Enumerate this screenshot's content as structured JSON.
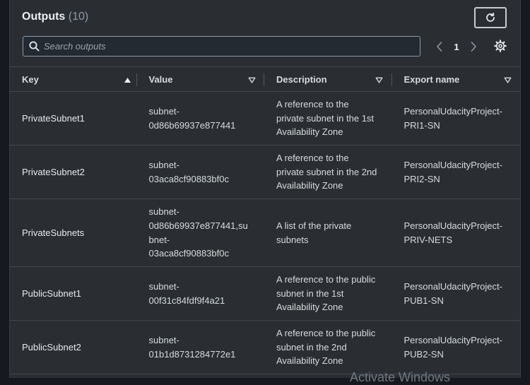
{
  "header": {
    "title": "Outputs",
    "count": "(10)"
  },
  "search": {
    "placeholder": "Search outputs",
    "value": ""
  },
  "pagination": {
    "current_page": "1"
  },
  "table": {
    "columns": [
      {
        "label": "Key",
        "sort": "ascending"
      },
      {
        "label": "Value",
        "sort": "none"
      },
      {
        "label": "Description",
        "sort": "none"
      },
      {
        "label": "Export name",
        "sort": "none"
      }
    ],
    "rows": [
      {
        "key": "PrivateSubnet1",
        "value": "subnet-\n0d86b69937e877441",
        "description": "A reference to the\nprivate subnet in the 1st\nAvailability Zone",
        "export_name": "PersonalUdacityProject-\nPRI1-SN"
      },
      {
        "key": "PrivateSubnet2",
        "value": "subnet-\n03aca8cf90883bf0c",
        "description": "A reference to the\nprivate subnet in the 2nd\nAvailability Zone",
        "export_name": "PersonalUdacityProject-\nPRI2-SN"
      },
      {
        "key": "PrivateSubnets",
        "value": "subnet-\n0d86b69937e877441,su\nbnet-\n03aca8cf90883bf0c",
        "description": "A list of the private\nsubnets",
        "export_name": "PersonalUdacityProject-\nPRIV-NETS"
      },
      {
        "key": "PublicSubnet1",
        "value": "subnet-\n00f31c84fdf9f4a21",
        "description": "A reference to the public\nsubnet in the 1st\nAvailability Zone",
        "export_name": "PersonalUdacityProject-\nPUB1-SN"
      },
      {
        "key": "PublicSubnet2",
        "value": "subnet-\n01b1d8731284772e1",
        "description": "A reference to the public\nsubnet in the 2nd\nAvailability Zone",
        "export_name": "PersonalUdacityProject-\nPUB2-SN"
      }
    ]
  },
  "watermark": "Activate Windows",
  "icons": {
    "refresh": "refresh-icon",
    "search": "search-icon",
    "prev": "chevron-left-icon",
    "next": "chevron-right-icon",
    "settings": "gear-icon",
    "sort_asc": "caret-up-icon",
    "sort_none": "caret-down-icon"
  },
  "colors": {
    "background": "#2a2e33",
    "border": "#414750",
    "text": "#d5dbdb",
    "muted": "#8d99a8"
  }
}
